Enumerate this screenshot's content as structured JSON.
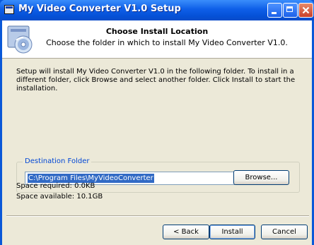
{
  "window": {
    "title": "My Video Converter V1.0 Setup"
  },
  "header": {
    "title": "Choose Install Location",
    "subtitle": "Choose the folder in which to install My Video Converter V1.0."
  },
  "intro": "Setup will install My Video Converter V1.0 in the following folder. To install in a different folder, click Browse and select another folder. Click Install to start the installation.",
  "destination": {
    "group_label": "Destination Folder",
    "path": "C:\\Program Files\\MyVideoConverter",
    "browse_label": "Browse..."
  },
  "space": {
    "required": "Space required: 0.0KB",
    "available": "Space available: 10.1GB"
  },
  "buttons": {
    "back": "< Back",
    "install": "Install",
    "cancel": "Cancel"
  },
  "colors": {
    "titlebar": "#0a58d8",
    "dialog_bg": "#ece9d8",
    "selection": "#316ac5",
    "group_label": "#0046d5"
  },
  "icons": [
    "installer-icon",
    "minimize-icon",
    "maximize-icon",
    "close-icon",
    "setup-disc-icon"
  ]
}
